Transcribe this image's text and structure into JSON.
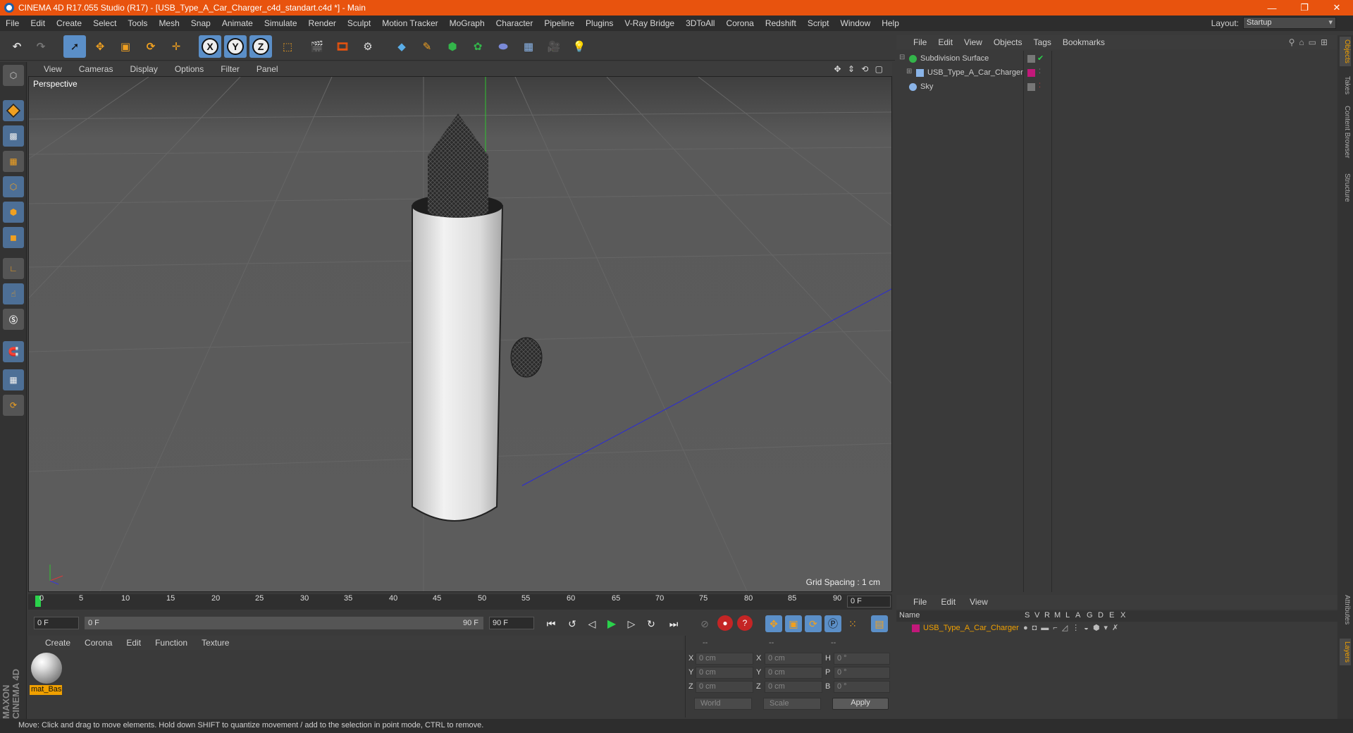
{
  "window": {
    "title": "CINEMA 4D R17.055 Studio (R17) - [USB_Type_A_Car_Charger_c4d_standart.c4d *] - Main",
    "minimize": "—",
    "restore": "❐",
    "close": "✕"
  },
  "menubar": {
    "items": [
      "File",
      "Edit",
      "Create",
      "Select",
      "Tools",
      "Mesh",
      "Snap",
      "Animate",
      "Simulate",
      "Render",
      "Sculpt",
      "Motion Tracker",
      "MoGraph",
      "Character",
      "Pipeline",
      "Plugins",
      "V-Ray Bridge",
      "3DToAll",
      "Corona",
      "Redshift",
      "Script",
      "Window",
      "Help"
    ],
    "layout_label": "Layout:",
    "layout_value": "Startup"
  },
  "toolbar": {
    "x_label": "X",
    "y_label": "Y",
    "z_label": "Z"
  },
  "viewport": {
    "menu": [
      "View",
      "Cameras",
      "Display",
      "Options",
      "Filter",
      "Panel"
    ],
    "nav_icons": "✥ ⇕ ⟲ ▢",
    "label": "Perspective",
    "grid_spacing": "Grid Spacing : 1 cm"
  },
  "timeline": {
    "ticks": [
      "0",
      "5",
      "10",
      "15",
      "20",
      "25",
      "30",
      "35",
      "40",
      "45",
      "50",
      "55",
      "60",
      "65",
      "70",
      "75",
      "80",
      "85",
      "90"
    ],
    "current_frame": "0 F",
    "start_field": "0 F",
    "range_start": "0 F",
    "range_end": "90 F",
    "end_field": "90 F"
  },
  "material_manager": {
    "menu": [
      "Create",
      "Corona",
      "Edit",
      "Function",
      "Texture"
    ],
    "material_name": "mat_Bas"
  },
  "coordinates": {
    "headers": [
      "--",
      "--",
      "--"
    ],
    "rows": [
      {
        "axis": "X",
        "pos": "0 cm",
        "axis2": "X",
        "size": "0 cm",
        "rot_label": "H",
        "rot": "0 °"
      },
      {
        "axis": "Y",
        "pos": "0 cm",
        "axis2": "Y",
        "size": "0 cm",
        "rot_label": "P",
        "rot": "0 °"
      },
      {
        "axis": "Z",
        "pos": "0 cm",
        "axis2": "Z",
        "size": "0 cm",
        "rot_label": "B",
        "rot": "0 °"
      }
    ],
    "space": "World",
    "mode": "Scale",
    "apply": "Apply"
  },
  "object_manager": {
    "menu": [
      "File",
      "Edit",
      "View",
      "Objects",
      "Tags",
      "Bookmarks"
    ],
    "objects": [
      {
        "name": "Subdivision Surface",
        "color": "#33b54a"
      },
      {
        "name": "USB_Type_A_Car_Charger",
        "color": "#8ab4e8"
      },
      {
        "name": "Sky",
        "color": "#8ab4e8"
      }
    ]
  },
  "layers": {
    "menu": [
      "File",
      "Edit",
      "View"
    ],
    "columns": [
      "Name",
      "S",
      "V",
      "R",
      "M",
      "L",
      "A",
      "G",
      "D",
      "E",
      "X"
    ],
    "row_name": "USB_Type_A_Car_Charger",
    "row_color": "#c2187a"
  },
  "side_tabs": [
    "Objects",
    "Takes",
    "Content Browser",
    "Structure",
    "Attributes",
    "Layers"
  ],
  "status": "Move: Click and drag to move elements. Hold down SHIFT to quantize movement / add to the selection in point mode, CTRL to remove.",
  "brand": "MAXON CINEMA 4D",
  "colors": {
    "accent": "#e8530e",
    "selection": "#5b8fc8",
    "material_label": "#f0a000"
  }
}
